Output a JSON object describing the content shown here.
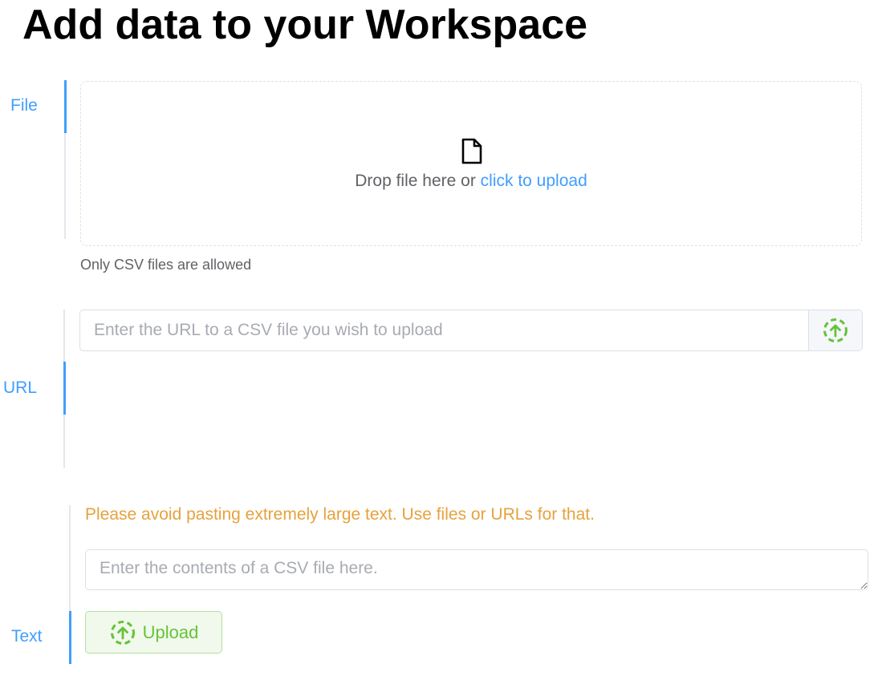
{
  "page": {
    "title": "Add data to your Workspace"
  },
  "tabs": {
    "file_label": "File",
    "url_label": "URL",
    "text_label": "Text"
  },
  "file_upload": {
    "drop_text": "Drop file here or",
    "link_text": "click to upload",
    "tip": "Only CSV files are allowed",
    "icon": "file-icon"
  },
  "url_upload": {
    "placeholder": "Enter the URL to a CSV file you wish to upload",
    "value": "",
    "button_icon": "upload-circle-icon"
  },
  "text_upload": {
    "warning": "Please avoid pasting extremely large text. Use files or URLs for that.",
    "placeholder": "Enter the contents of a CSV file here.",
    "value": "",
    "button_label": "Upload",
    "button_icon": "upload-circle-icon"
  },
  "colors": {
    "accent": "#409eff",
    "success": "#67c23a",
    "warning": "#e6a23c"
  }
}
